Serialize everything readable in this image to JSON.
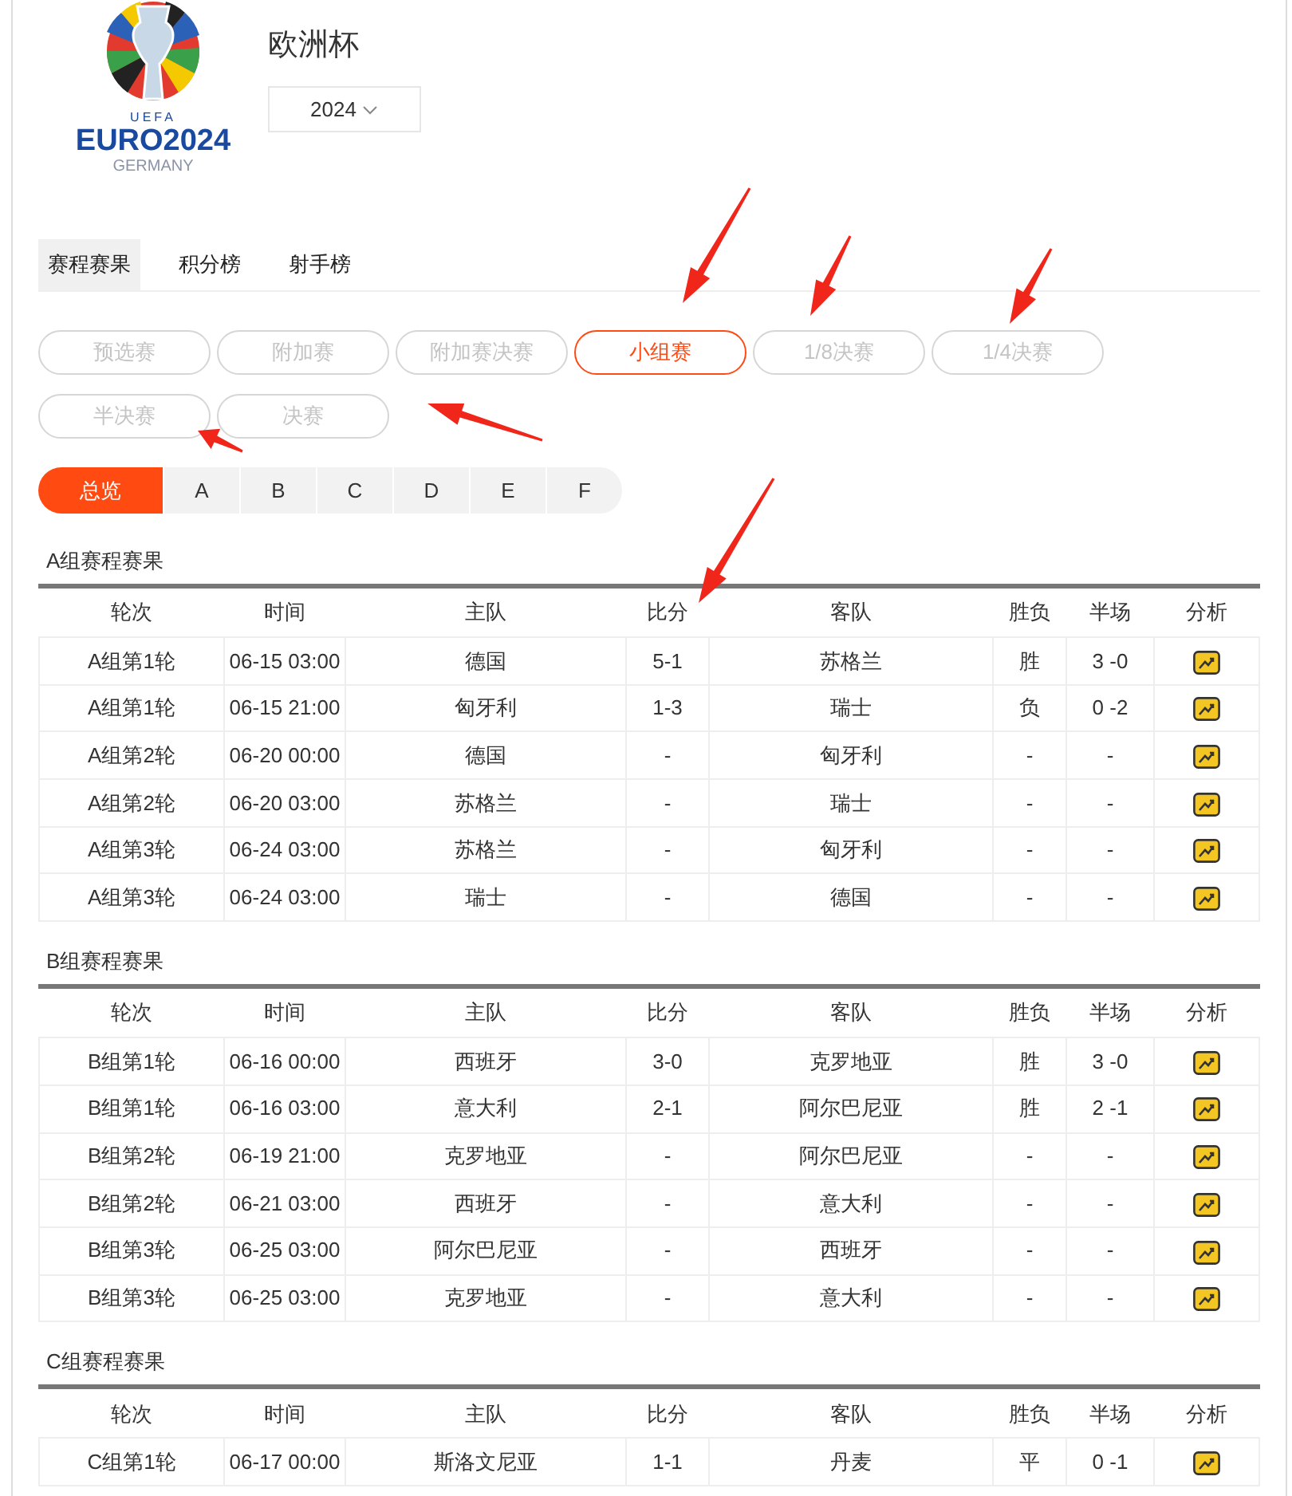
{
  "logo": {
    "top": "UEFA",
    "main": "EURO2024",
    "sub": "GERMANY"
  },
  "title": "欧洲杯",
  "season": {
    "value": "2024"
  },
  "tabs": [
    {
      "label": "赛程赛果",
      "selected": true
    },
    {
      "label": "积分榜",
      "selected": false
    },
    {
      "label": "射手榜",
      "selected": false
    }
  ],
  "stages": [
    {
      "label": "预选赛",
      "selected": false
    },
    {
      "label": "附加赛",
      "selected": false
    },
    {
      "label": "附加赛决赛",
      "selected": false
    },
    {
      "label": "小组赛",
      "selected": true
    },
    {
      "label": "1/8决赛",
      "selected": false
    },
    {
      "label": "1/4决赛",
      "selected": false
    },
    {
      "label": "半决赛",
      "selected": false
    },
    {
      "label": "决赛",
      "selected": false
    }
  ],
  "groups": [
    {
      "label": "总览",
      "selected": true
    },
    {
      "label": "A",
      "selected": false
    },
    {
      "label": "B",
      "selected": false
    },
    {
      "label": "C",
      "selected": false
    },
    {
      "label": "D",
      "selected": false
    },
    {
      "label": "E",
      "selected": false
    },
    {
      "label": "F",
      "selected": false
    }
  ],
  "sections": [
    {
      "title": "A组赛程赛果",
      "columns": [
        "轮次",
        "时间",
        "主队",
        "比分",
        "客队",
        "胜负",
        "半场",
        "分析"
      ],
      "rows": [
        [
          "A组第1轮",
          "06-15 03:00",
          "德国",
          "5-1",
          "苏格兰",
          "胜",
          "3 -0"
        ],
        [
          "A组第1轮",
          "06-15 21:00",
          "匈牙利",
          "1-3",
          "瑞士",
          "负",
          "0 -2"
        ],
        [
          "A组第2轮",
          "06-20 00:00",
          "德国",
          "-",
          "匈牙利",
          "-",
          "-"
        ],
        [
          "A组第2轮",
          "06-20 03:00",
          "苏格兰",
          "-",
          "瑞士",
          "-",
          "-"
        ],
        [
          "A组第3轮",
          "06-24 03:00",
          "苏格兰",
          "-",
          "匈牙利",
          "-",
          "-"
        ],
        [
          "A组第3轮",
          "06-24 03:00",
          "瑞士",
          "-",
          "德国",
          "-",
          "-"
        ]
      ]
    },
    {
      "title": "B组赛程赛果",
      "columns": [
        "轮次",
        "时间",
        "主队",
        "比分",
        "客队",
        "胜负",
        "半场",
        "分析"
      ],
      "rows": [
        [
          "B组第1轮",
          "06-16 00:00",
          "西班牙",
          "3-0",
          "克罗地亚",
          "胜",
          "3 -0"
        ],
        [
          "B组第1轮",
          "06-16 03:00",
          "意大利",
          "2-1",
          "阿尔巴尼亚",
          "胜",
          "2 -1"
        ],
        [
          "B组第2轮",
          "06-19 21:00",
          "克罗地亚",
          "-",
          "阿尔巴尼亚",
          "-",
          "-"
        ],
        [
          "B组第2轮",
          "06-21 03:00",
          "西班牙",
          "-",
          "意大利",
          "-",
          "-"
        ],
        [
          "B组第3轮",
          "06-25 03:00",
          "阿尔巴尼亚",
          "-",
          "西班牙",
          "-",
          "-"
        ],
        [
          "B组第3轮",
          "06-25 03:00",
          "克罗地亚",
          "-",
          "意大利",
          "-",
          "-"
        ]
      ]
    },
    {
      "title": "C组赛程赛果",
      "columns": [
        "轮次",
        "时间",
        "主队",
        "比分",
        "客队",
        "胜负",
        "半场",
        "分析"
      ],
      "rows": [
        [
          "C组第1轮",
          "06-17 00:00",
          "斯洛文尼亚",
          "1-1",
          "丹麦",
          "平",
          "0 -1"
        ]
      ]
    }
  ]
}
